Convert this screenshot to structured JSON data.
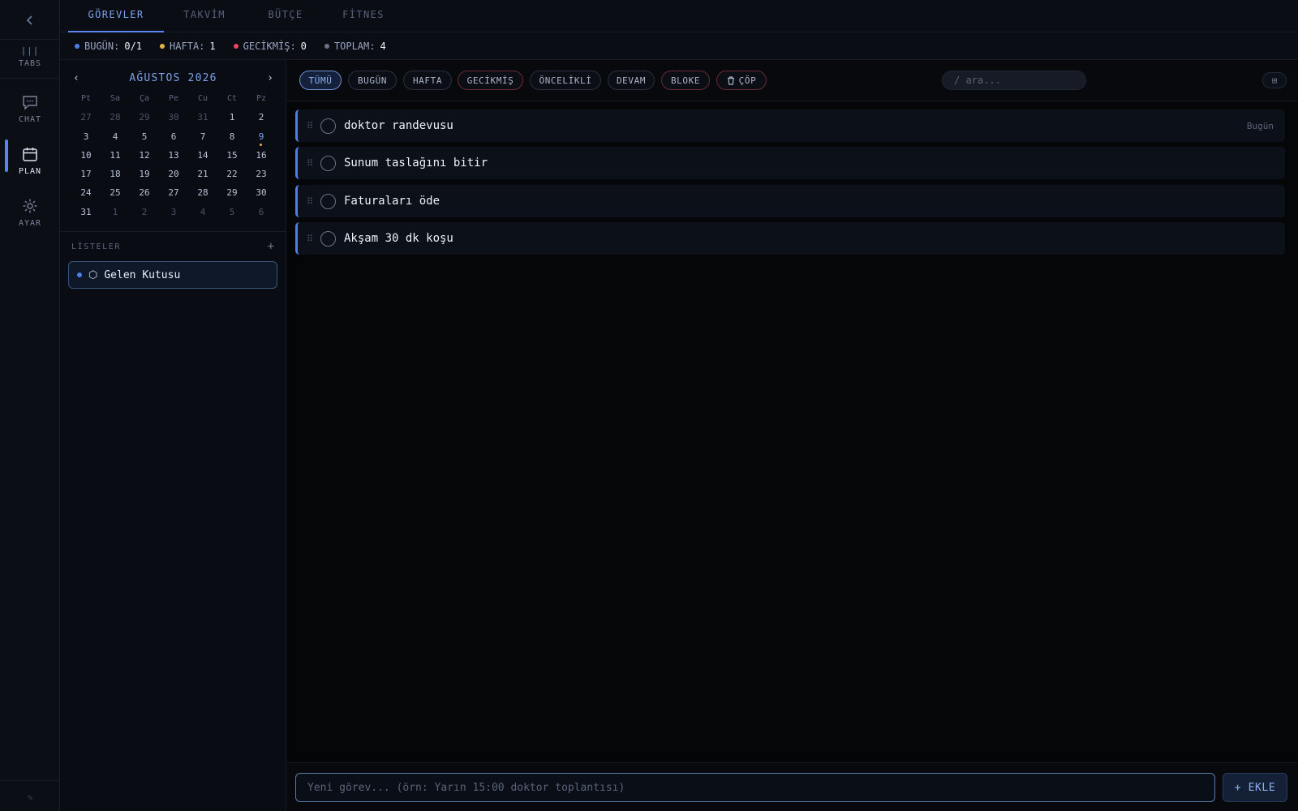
{
  "rail": {
    "items": [
      {
        "id": "tabs",
        "label": "TABS",
        "icon": "bars-icon"
      },
      {
        "id": "chat",
        "label": "CHAT",
        "icon": "chat-bubble-icon"
      },
      {
        "id": "plan",
        "label": "PLAN",
        "icon": "calendar-icon",
        "active": true
      },
      {
        "id": "ayar",
        "label": "AYAR",
        "icon": "gear-icon"
      }
    ],
    "footer": "✎"
  },
  "tabs": [
    {
      "label": "GÖREVLER",
      "active": true
    },
    {
      "label": "TAKVİM"
    },
    {
      "label": "BÜTÇE"
    },
    {
      "label": "FİTNES"
    }
  ],
  "stats": [
    {
      "key": "BUGÜN:",
      "value": "0/1",
      "color": "#4f7fe6"
    },
    {
      "key": "HAFTA:",
      "value": "1",
      "color": "#e8b441"
    },
    {
      "key": "GECİKMİŞ:",
      "value": "0",
      "color": "#e8485c"
    },
    {
      "key": "TOPLAM:",
      "value": "4",
      "color": "#6b7385"
    }
  ],
  "calendar": {
    "month_label": "AĞUSTOS 2026",
    "prev": "‹",
    "next": "›",
    "weekdays": [
      "Pt",
      "Sa",
      "Ça",
      "Pe",
      "Cu",
      "Ct",
      "Pz"
    ],
    "days": [
      {
        "n": "27",
        "muted": true
      },
      {
        "n": "28",
        "muted": true
      },
      {
        "n": "29",
        "muted": true
      },
      {
        "n": "30",
        "muted": true
      },
      {
        "n": "31",
        "muted": true
      },
      {
        "n": "1"
      },
      {
        "n": "2"
      },
      {
        "n": "3"
      },
      {
        "n": "4"
      },
      {
        "n": "5"
      },
      {
        "n": "6"
      },
      {
        "n": "7"
      },
      {
        "n": "8"
      },
      {
        "n": "9",
        "today": true
      },
      {
        "n": "10"
      },
      {
        "n": "11"
      },
      {
        "n": "12"
      },
      {
        "n": "13"
      },
      {
        "n": "14"
      },
      {
        "n": "15"
      },
      {
        "n": "16"
      },
      {
        "n": "17"
      },
      {
        "n": "18"
      },
      {
        "n": "19"
      },
      {
        "n": "20"
      },
      {
        "n": "21"
      },
      {
        "n": "22"
      },
      {
        "n": "23"
      },
      {
        "n": "24"
      },
      {
        "n": "25"
      },
      {
        "n": "26"
      },
      {
        "n": "27"
      },
      {
        "n": "28"
      },
      {
        "n": "29"
      },
      {
        "n": "30"
      },
      {
        "n": "31"
      },
      {
        "n": "1",
        "muted": true
      },
      {
        "n": "2",
        "muted": true
      },
      {
        "n": "3",
        "muted": true
      },
      {
        "n": "4",
        "muted": true
      },
      {
        "n": "5",
        "muted": true
      },
      {
        "n": "6",
        "muted": true
      }
    ]
  },
  "lists": {
    "title": "LİSTELER",
    "add": "+",
    "items": [
      {
        "label": "Gelen Kutusu",
        "icon": "⬡"
      }
    ]
  },
  "filters": [
    {
      "label": "TÜMÜ",
      "active": true
    },
    {
      "label": "BUGÜN"
    },
    {
      "label": "HAFTA"
    },
    {
      "label": "GECİKMİŞ",
      "red": true
    },
    {
      "label": "ÖNCELİKLİ"
    },
    {
      "label": "DEVAM"
    },
    {
      "label": "BLOKE",
      "red": true
    },
    {
      "label": "ÇÖP",
      "red": true,
      "icon": "trash-icon"
    }
  ],
  "search": {
    "placeholder": "/ ara..."
  },
  "view_toggle": "⊞",
  "tasks": [
    {
      "title": "doktor randevusu",
      "due": "Bugün"
    },
    {
      "title": "Sunum taslağını bitir",
      "due": ""
    },
    {
      "title": "Faturaları öde",
      "due": ""
    },
    {
      "title": "Akşam 30 dk koşu",
      "due": ""
    }
  ],
  "composer": {
    "placeholder": "Yeni görev... (örn: Yarın 15:00 doktor toplantısı)",
    "add_label": "+ EKLE"
  }
}
